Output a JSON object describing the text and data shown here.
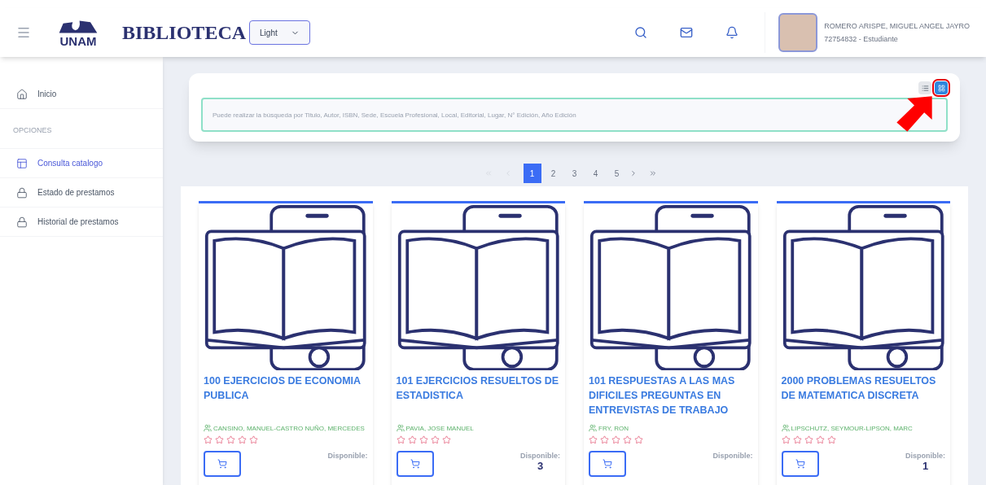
{
  "header": {
    "brand": "UNAM",
    "title": "BIBLIOTECA",
    "theme_select": {
      "value": "Light"
    },
    "user": {
      "name": "ROMERO ARISPE, MIGUEL ANGEL JAYRO",
      "subtitle": "72754832 - Estudiante"
    }
  },
  "sidebar": {
    "items": [
      {
        "kind": "link",
        "label": "Inicio",
        "selected": false
      },
      {
        "kind": "section",
        "label": "OPCIONES"
      },
      {
        "kind": "link",
        "label": "Consulta catalogo",
        "selected": true
      },
      {
        "kind": "link",
        "label": "Estado de prestamos",
        "selected": false
      },
      {
        "kind": "link",
        "label": "Historial de prestamos",
        "selected": false
      }
    ]
  },
  "search": {
    "placeholder": "Puede realizar la búsqueda por Titulo, Autor, ISBN, Sede, Escuela Profesional, Local, Editorial, Lugar, N° Edición, Año Edición",
    "view_toggle": [
      {
        "kind": "list",
        "selected": false
      },
      {
        "kind": "grid",
        "selected": true
      }
    ]
  },
  "pagination": {
    "pages": [
      {
        "label": "1",
        "selected": true
      },
      {
        "label": "2",
        "selected": false
      },
      {
        "label": "3",
        "selected": false
      },
      {
        "label": "4",
        "selected": false
      },
      {
        "label": "5",
        "selected": false
      }
    ]
  },
  "books": [
    {
      "title": "100 EJERCICIOS DE ECONOMIA PUBLICA",
      "author": "CANSINO, MANUEL-CASTRO NUÑO, MERCEDES",
      "stars": 0,
      "available_label": "Disponible:"
    },
    {
      "title": "101 EJERCICIOS RESUELTOS DE ESTADISTICA",
      "author": "PAVIA, JOSE MANUEL",
      "stars": 0,
      "available_label": "Disponible:",
      "available": "3"
    },
    {
      "title": "101 RESPUESTAS A LAS MAS DIFICILES PREGUNTAS EN ENTREVISTAS DE TRABAJO",
      "author": "FRY, RON",
      "stars": 0,
      "available_label": "Disponible:"
    },
    {
      "title": "2000 PROBLEMAS RESUELTOS DE MATEMATICA DISCRETA",
      "author": "LIPSCHUTZ, SEYMOUR-LIPSON, MARC",
      "stars": 0,
      "available_label": "Disponible:",
      "available": "1"
    }
  ]
}
